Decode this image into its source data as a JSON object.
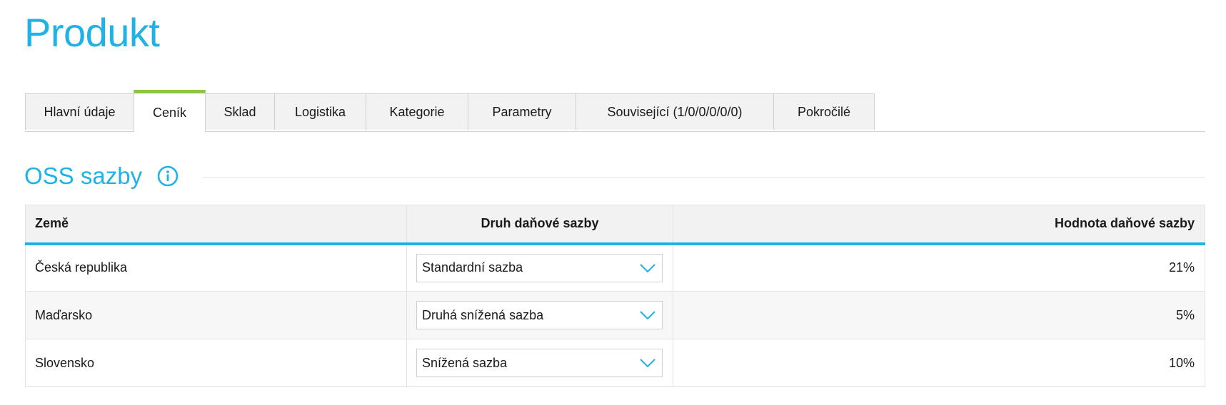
{
  "page": {
    "title": "Produkt"
  },
  "tabs": [
    {
      "label": "Hlavní údaje",
      "active": false
    },
    {
      "label": "Ceník",
      "active": true
    },
    {
      "label": "Sklad",
      "active": false
    },
    {
      "label": "Logistika",
      "active": false
    },
    {
      "label": "Kategorie",
      "active": false
    },
    {
      "label": "Parametry",
      "active": false
    },
    {
      "label": "Související (1/0/0/0/0/0)",
      "active": false
    },
    {
      "label": "Pokročilé",
      "active": false
    }
  ],
  "section": {
    "title": "OSS sazby",
    "icon": "info-icon"
  },
  "table": {
    "headers": {
      "country": "Země",
      "rate_type": "Druh daňové sazby",
      "rate_value": "Hodnota daňové sazby"
    },
    "rows": [
      {
        "country": "Česká republika",
        "rate_type": "Standardní sazba",
        "rate_value": "21%"
      },
      {
        "country": "Maďarsko",
        "rate_type": "Druhá snížená sazba",
        "rate_value": "5%"
      },
      {
        "country": "Slovensko",
        "rate_type": "Snížená sazba",
        "rate_value": "10%"
      }
    ]
  },
  "colors": {
    "accent": "#1fb3e5",
    "active_tab": "#8cc63f"
  }
}
